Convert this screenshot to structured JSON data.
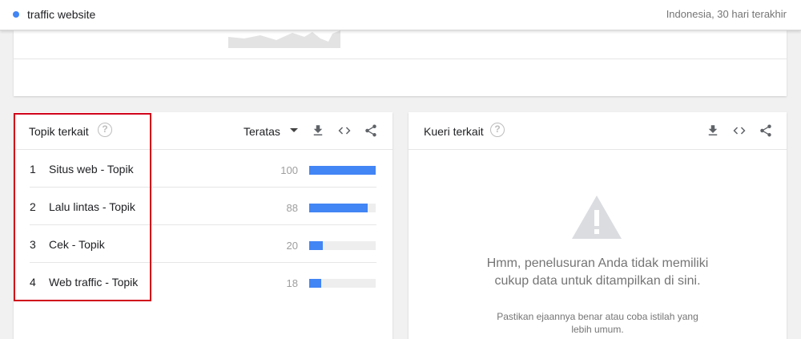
{
  "search": {
    "term": "traffic website",
    "term_color": "#4285f4",
    "filter": "Indonesia, 30 hari terakhir"
  },
  "related_topics": {
    "title": "Topik terkait",
    "help": "?",
    "sort_label": "Teratas",
    "icons": [
      "download-icon",
      "embed-icon",
      "share-icon"
    ],
    "rows": [
      {
        "index": "1",
        "name": "Situs web - Topik",
        "value": "100",
        "score": 100
      },
      {
        "index": "2",
        "name": "Lalu lintas - Topik",
        "value": "88",
        "score": 88
      },
      {
        "index": "3",
        "name": "Cek - Topik",
        "value": "20",
        "score": 20
      },
      {
        "index": "4",
        "name": "Web traffic - Topik",
        "value": "18",
        "score": 18
      }
    ],
    "bar_color": "#4285f4"
  },
  "related_queries": {
    "title": "Kueri terkait",
    "help": "?",
    "icons": [
      "download-icon",
      "embed-icon",
      "share-icon"
    ],
    "empty_message": "Hmm, penelusuran Anda tidak memiliki cukup data untuk ditampilkan di sini.",
    "empty_hint": "Pastikan ejaannya benar atau coba istilah yang lebih umum."
  },
  "highlight_color": "#d0021b"
}
